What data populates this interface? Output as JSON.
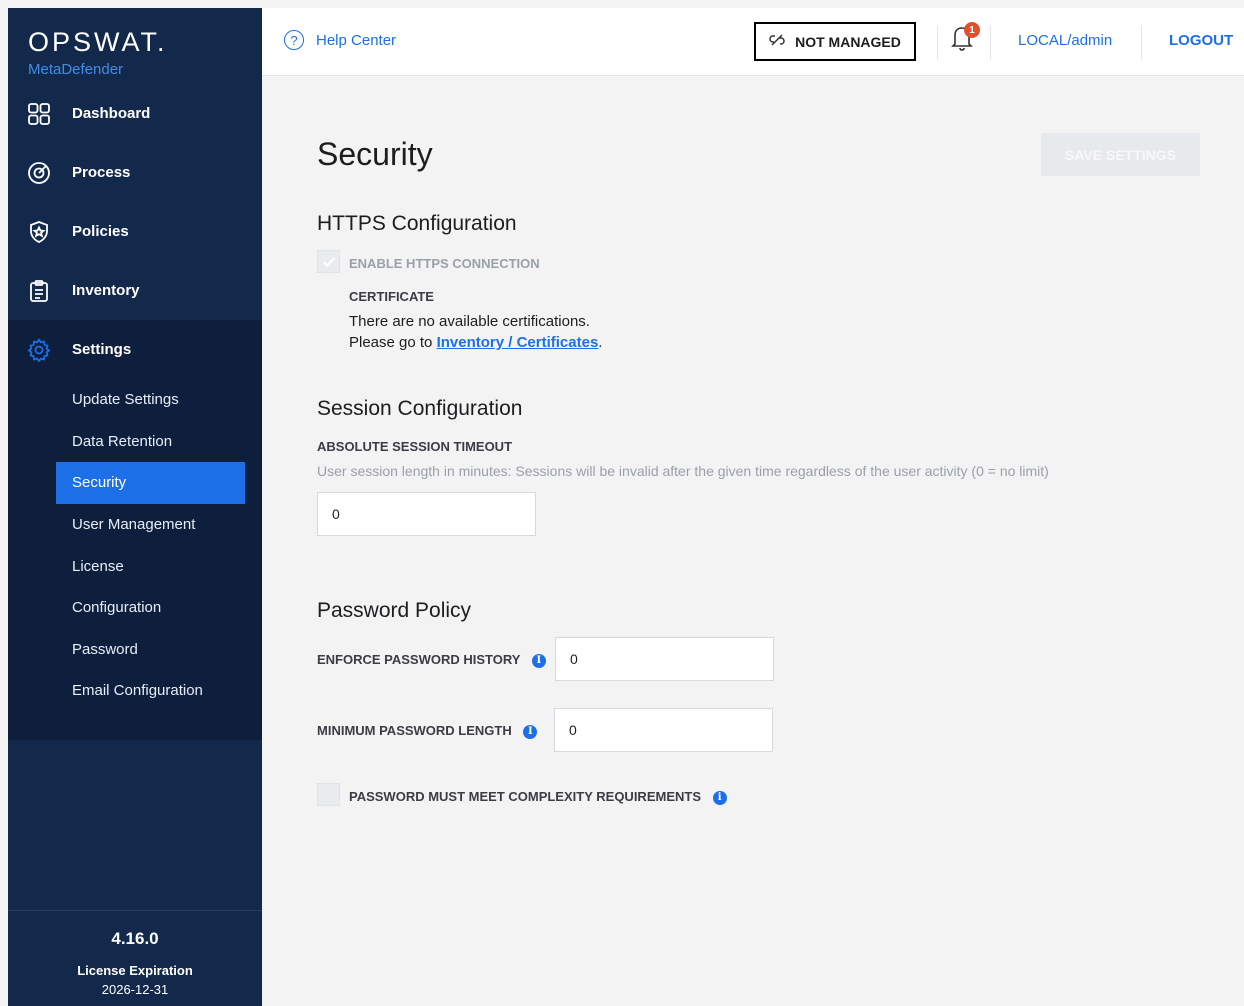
{
  "brand": {
    "logo": "OPSWAT.",
    "product": "MetaDefender"
  },
  "nav": {
    "dashboard": "Dashboard",
    "process": "Process",
    "policies": "Policies",
    "inventory": "Inventory",
    "settings": "Settings"
  },
  "settings_sub": [
    {
      "label": "Update Settings"
    },
    {
      "label": "Data Retention"
    },
    {
      "label": "Security"
    },
    {
      "label": "User Management"
    },
    {
      "label": "License"
    },
    {
      "label": "Configuration"
    },
    {
      "label": "Password"
    },
    {
      "label": "Email Configuration"
    }
  ],
  "footer": {
    "version": "4.16.0",
    "license_label": "License Expiration",
    "license_date": "2026-12-31"
  },
  "topbar": {
    "help": "Help Center",
    "not_managed": "NOT MANAGED",
    "notification_count": "1",
    "user": "LOCAL/admin",
    "logout": "LOGOUT"
  },
  "page": {
    "title": "Security",
    "save_button": "SAVE SETTINGS",
    "https": {
      "title": "HTTPS Configuration",
      "enable_label": "ENABLE HTTPS CONNECTION",
      "certificate_label": "CERTIFICATE",
      "no_cert_text": "There are no available certifications.",
      "go_to_text": "Please go to",
      "link_text": "Inventory / Certificates",
      "trailing": "."
    },
    "session": {
      "title": "Session Configuration",
      "timeout_label": "ABSOLUTE SESSION TIMEOUT",
      "hint": "User session length in minutes: Sessions will be invalid after the given time regardless of the user activity (0 = no limit)",
      "timeout_value": "0"
    },
    "password": {
      "title": "Password Policy",
      "history_label": "ENFORCE PASSWORD HISTORY",
      "history_value": "0",
      "min_length_label": "MINIMUM PASSWORD LENGTH",
      "min_length_value": "0",
      "complexity_label": "PASSWORD MUST MEET COMPLEXITY REQUIREMENTS"
    }
  },
  "colors": {
    "sidebar": "#13294b",
    "accent": "#1d6fe8",
    "badge": "#e0502f"
  }
}
